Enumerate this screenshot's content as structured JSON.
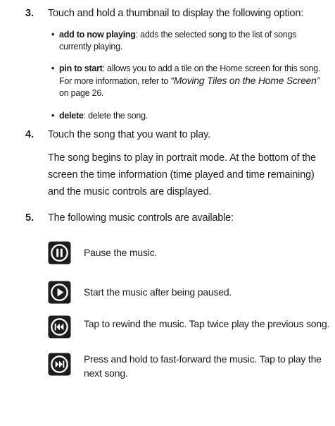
{
  "steps": {
    "s3": {
      "num": "3.",
      "text": "Touch and hold a thumbnail to display the following option:"
    },
    "bullets": [
      {
        "dot": "•",
        "term": "add to now playing",
        "desc": ": adds the selected song to the list of songs currently playing."
      },
      {
        "dot": "•",
        "term": "pin to start",
        "desc": ": allows you to add a tile on the Home screen for this song. For more information, refer to ",
        "ref": "“Moving Tiles on the Home Screen”",
        "after": "  on page 26."
      },
      {
        "dot": "•",
        "term": "delete",
        "desc": ": delete the song."
      }
    ],
    "s4": {
      "num": "4.",
      "text": "Touch the song that you want to play.",
      "para": "The song begins to play in portrait mode. At the bottom of the screen the time information (time played and time remaining) and the music controls are displayed."
    },
    "s5": {
      "num": "5.",
      "text": "The following music controls are available:"
    }
  },
  "controls": [
    {
      "icon": "pause-icon",
      "text": "Pause the music."
    },
    {
      "icon": "play-icon",
      "text": "Start the music after being paused."
    },
    {
      "icon": "rewind-icon",
      "text": "Tap to rewind the music. Tap twice play the previous song."
    },
    {
      "icon": "fast-forward-icon",
      "text": "Press and hold to fast-forward the music. Tap to play the next song."
    }
  ],
  "colors": {
    "icon_fill": "#1c1c1c",
    "icon_glyph": "#ffffff",
    "text": "#1a1a1a"
  }
}
